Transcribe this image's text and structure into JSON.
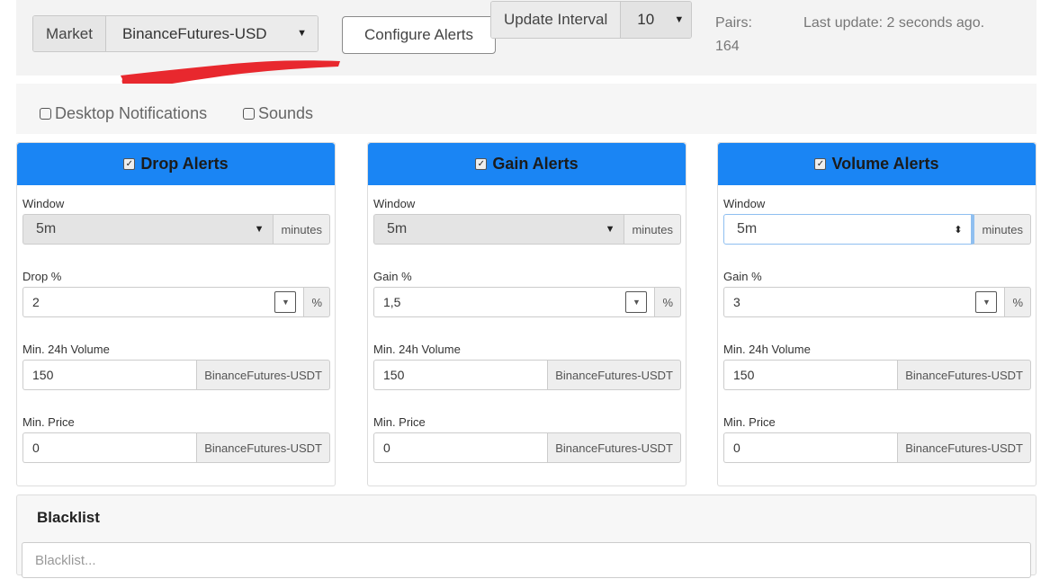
{
  "topbar": {
    "market_label": "Market",
    "market_value": "BinanceFutures-USD",
    "configure_alerts": "Configure Alerts",
    "update_interval_label": "Update Interval",
    "update_interval_value": "10",
    "pairs": "Pairs: 164",
    "last_update": "Last update: 2 seconds ago."
  },
  "settings": {
    "desktop_notifications": "Desktop Notifications",
    "sounds": "Sounds"
  },
  "panels": [
    {
      "title": "Drop Alerts",
      "window_label": "Window",
      "window_value": "5m",
      "window_unit": "minutes",
      "pct_label": "Drop %",
      "pct_value": "2",
      "pct_unit": "%",
      "vol_label": "Min. 24h Volume",
      "vol_value": "150",
      "vol_unit": "BinanceFutures-USDT",
      "price_label": "Min. Price",
      "price_value": "0",
      "price_unit": "BinanceFutures-USDT"
    },
    {
      "title": "Gain Alerts",
      "window_label": "Window",
      "window_value": "5m",
      "window_unit": "minutes",
      "pct_label": "Gain %",
      "pct_value": "1,5",
      "pct_unit": "%",
      "vol_label": "Min. 24h Volume",
      "vol_value": "150",
      "vol_unit": "BinanceFutures-USDT",
      "price_label": "Min. Price",
      "price_value": "0",
      "price_unit": "BinanceFutures-USDT"
    },
    {
      "title": "Volume Alerts",
      "window_label": "Window",
      "window_value": "5m",
      "window_unit": "minutes",
      "pct_label": "Gain %",
      "pct_value": "3",
      "pct_unit": "%",
      "vol_label": "Min. 24h Volume",
      "vol_value": "150",
      "vol_unit": "BinanceFutures-USDT",
      "price_label": "Min. Price",
      "price_value": "0",
      "price_unit": "BinanceFutures-USDT"
    }
  ],
  "blacklist": {
    "title": "Blacklist",
    "placeholder": "Blacklist..."
  },
  "colors": {
    "panel_header": "#1a85f4",
    "annotation_scribble": "#e8282e"
  }
}
